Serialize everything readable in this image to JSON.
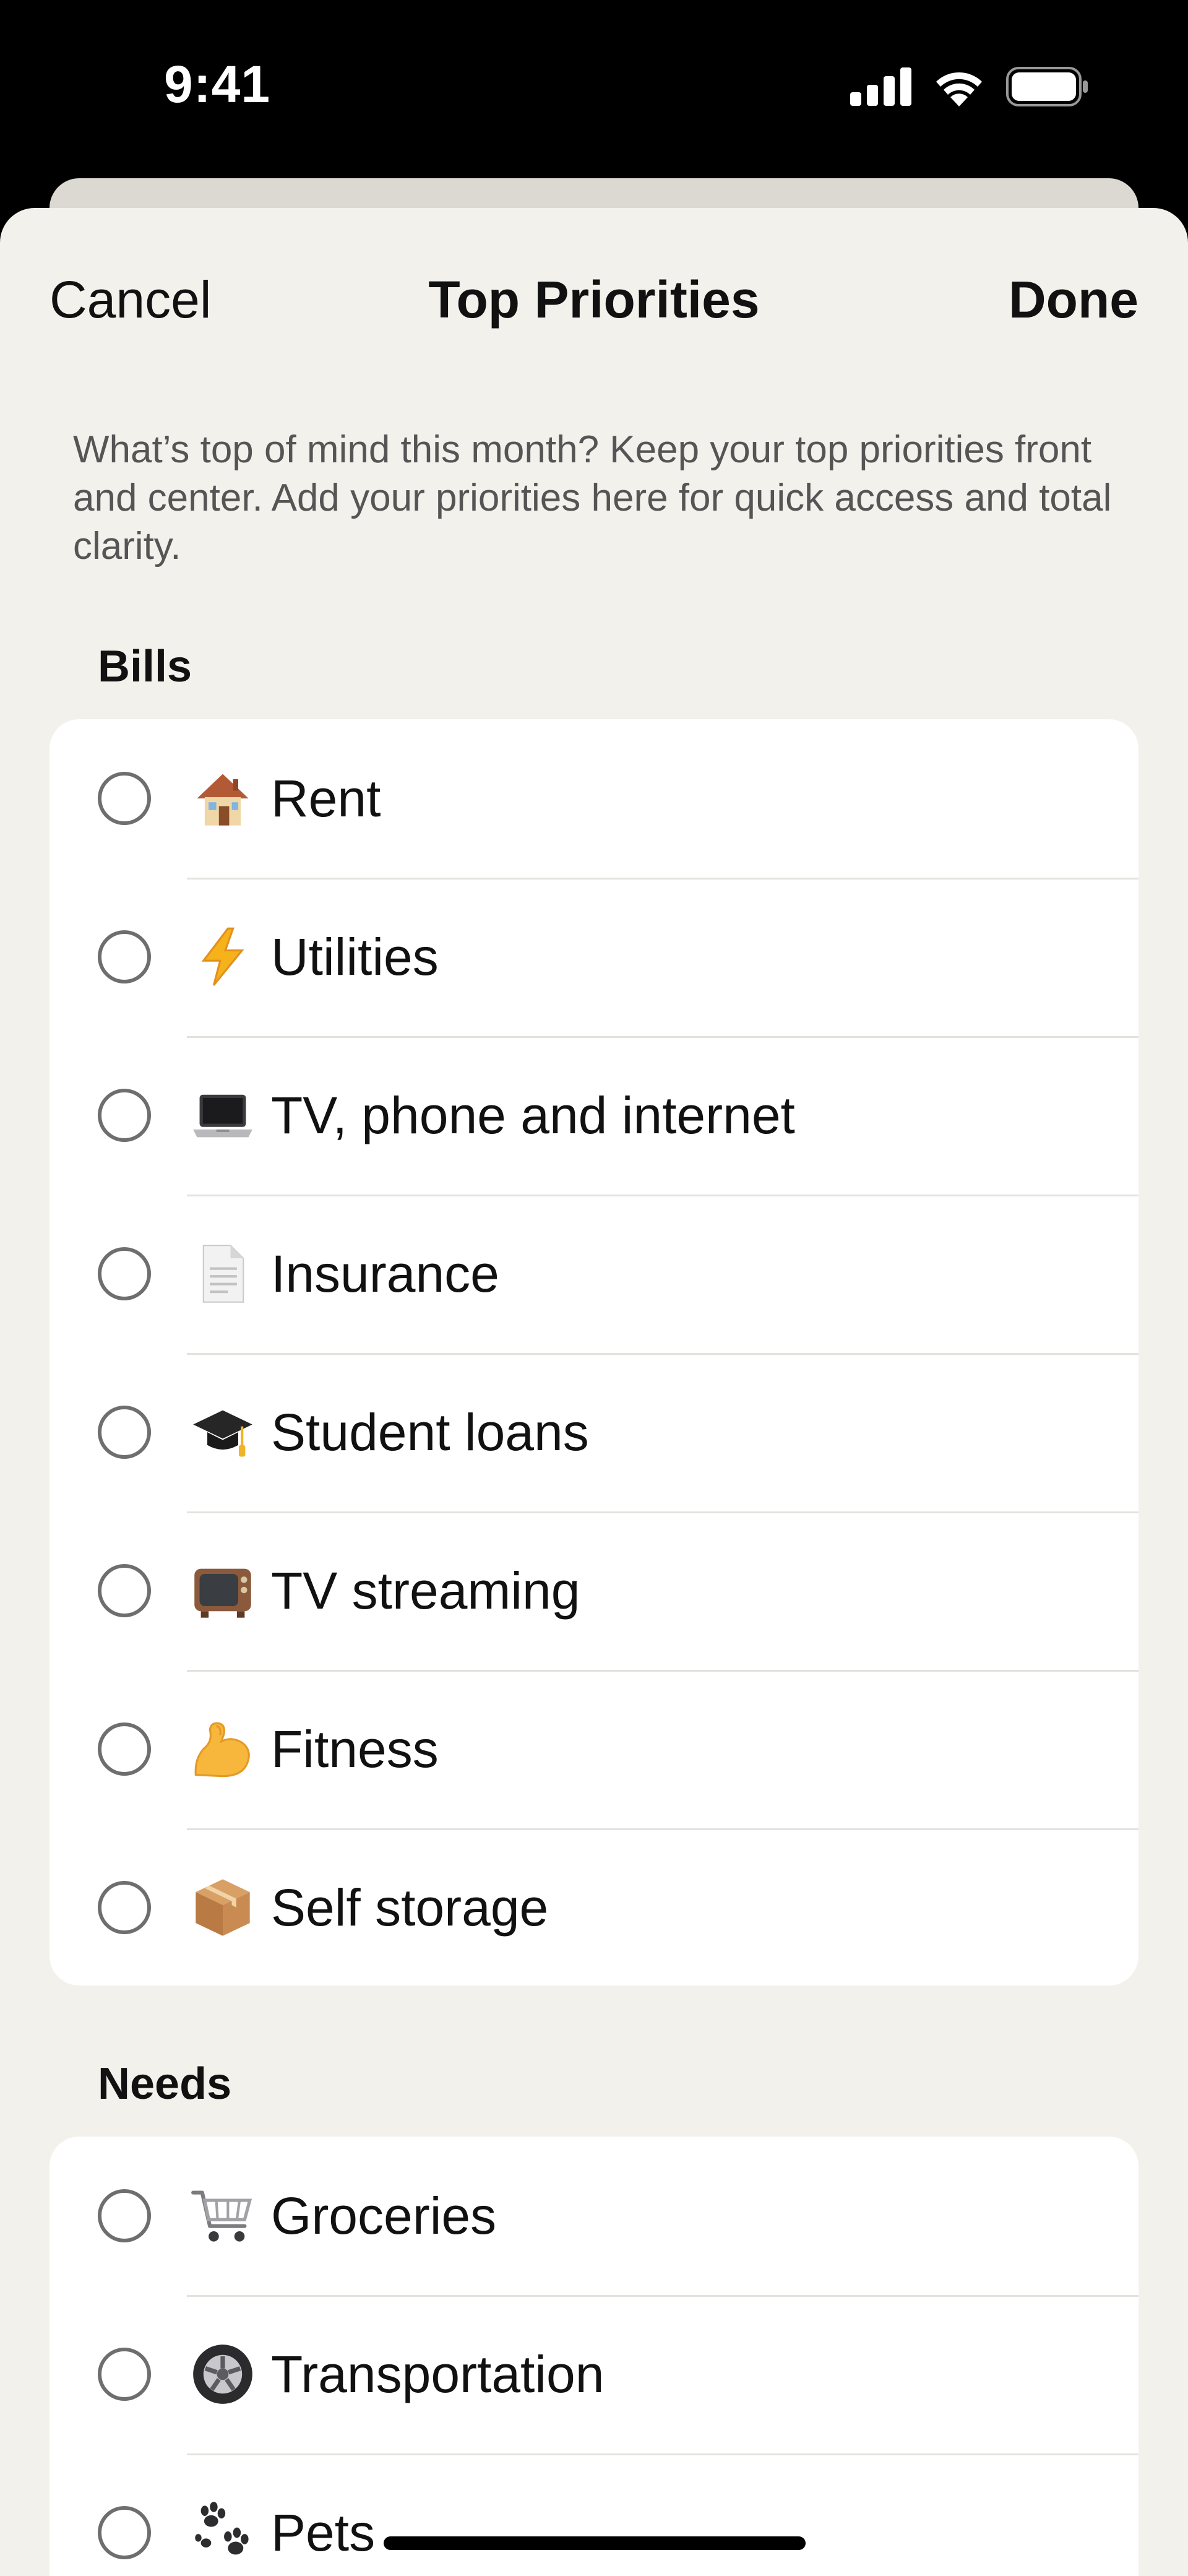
{
  "status_bar": {
    "time": "9:41"
  },
  "nav": {
    "cancel_label": "Cancel",
    "title": "Top Priorities",
    "done_label": "Done"
  },
  "intro": "What’s top of mind this month? Keep your top priorities front and center. Add your priorities here for quick access and total clarity.",
  "sections": [
    {
      "title": "Bills",
      "items": [
        {
          "label": "Rent",
          "icon": "house-emoji-icon",
          "selected": false
        },
        {
          "label": "Utilities",
          "icon": "lightning-emoji-icon",
          "selected": false
        },
        {
          "label": "TV, phone and internet",
          "icon": "laptop-emoji-icon",
          "selected": false
        },
        {
          "label": "Insurance",
          "icon": "document-emoji-icon",
          "selected": false
        },
        {
          "label": "Student loans",
          "icon": "graduation-cap-emoji-icon",
          "selected": false
        },
        {
          "label": "TV streaming",
          "icon": "television-emoji-icon",
          "selected": false
        },
        {
          "label": "Fitness",
          "icon": "flexed-biceps-emoji-icon",
          "selected": false
        },
        {
          "label": "Self storage",
          "icon": "package-emoji-icon",
          "selected": false
        }
      ]
    },
    {
      "title": "Needs",
      "items": [
        {
          "label": "Groceries",
          "icon": "shopping-cart-emoji-icon",
          "selected": false
        },
        {
          "label": "Transportation",
          "icon": "wheel-emoji-icon",
          "selected": false
        },
        {
          "label": "Pets",
          "icon": "paw-prints-emoji-icon",
          "selected": false
        }
      ]
    }
  ]
}
